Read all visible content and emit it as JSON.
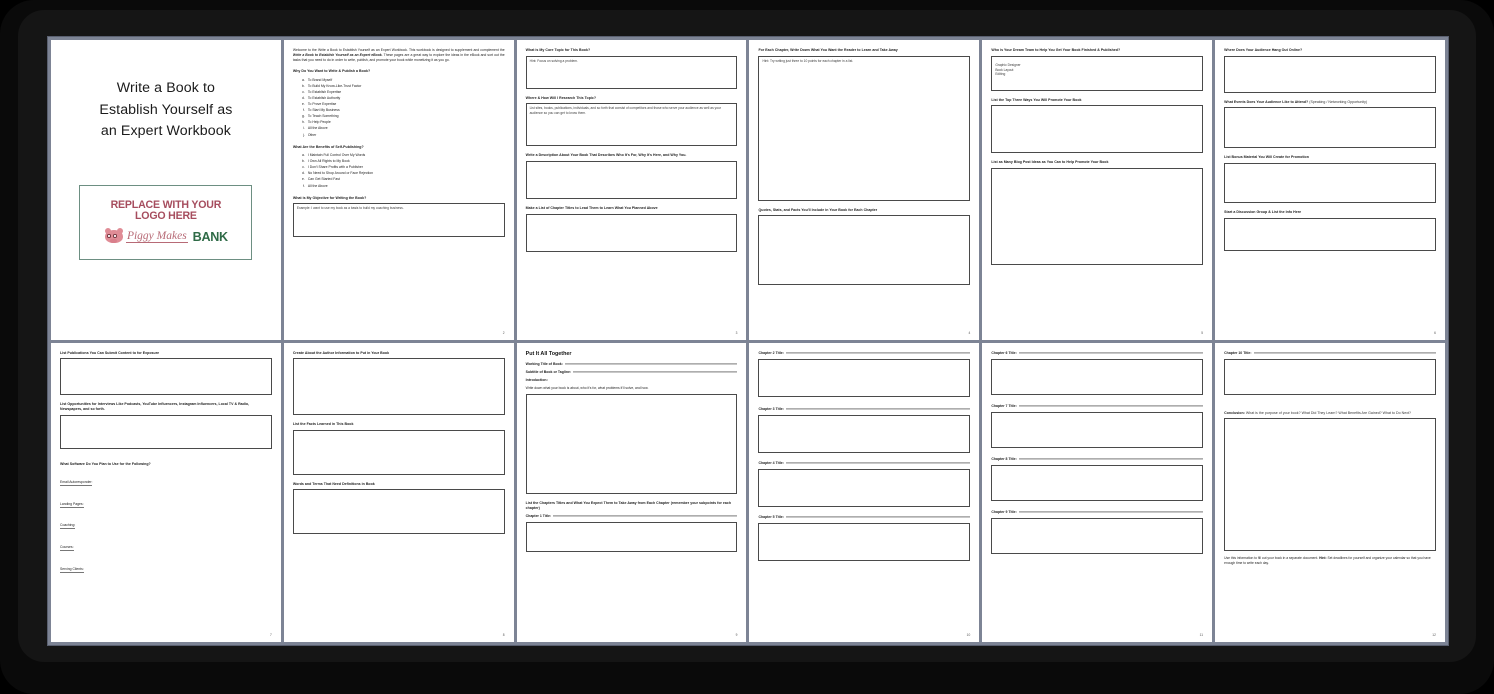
{
  "viewer": {
    "kind": "pdf-thumbnail-grid",
    "columns": 6,
    "rows": 2,
    "total_pages": 12
  },
  "cover": {
    "title": "Write a Book to Establish Yourself as an Expert Workbook",
    "title_lines": [
      "Write a Book to",
      "Establish Yourself as",
      "an Expert Workbook"
    ],
    "logo_placeholder_line1": "REPLACE WITH YOUR",
    "logo_placeholder_line2": "LOGO HERE",
    "brand_piggy": "Piggy Makes",
    "brand_bank": "BANK",
    "colors": {
      "placeholder_text": "#a64d5e",
      "logo_box_border": "#6d8f82",
      "piggy_pink": "#e08c96",
      "bank_green": "#2f6b47"
    }
  },
  "page2": {
    "page_number": "2",
    "intro_a": "Welcome to the Write a Book to Establish Yourself as an Expert Workbook. This workbook is designed to supplement and complement the ",
    "intro_b": "Write a Book to Establish Yourself as an Expert eBook.",
    "intro_c": " These pages are a great way to explore the ideas in the eBook and sort out the tasks that you need to do in order to write, publish, and promote your book while monetizing it as you go.",
    "q1": "Why Do You Want to Write & Publish a Book?",
    "q1_options": [
      "To Brand Myself",
      "To Build My Know-Like-Trust Factor",
      "To Establish Expertise",
      "To Establish Authority",
      "To Prove Expertise",
      "To Start My Business",
      "To Teach Something",
      "To Help People",
      "All the Above",
      "Other"
    ],
    "q2": "What Are the Benefits of Self-Publishing?",
    "q2_options": [
      "I Maintain Full Control Over My Words",
      "I Own All Rights to My Book",
      "I Don't Share Profits with a Publisher",
      "No Need to Shop Around or Face Rejection",
      "Can Get Started Fast",
      "All the Above"
    ],
    "q3": "What is My Objective for Writing the Book?",
    "q3_prefill": "Example: I want to use my book as a basis to build my coaching business."
  },
  "page3": {
    "page_number": "3",
    "q1": "What is My Core Topic for This Book?",
    "q1_prefill": "Hint: Focus on solving a problem.",
    "q2": "Where & How Will I Research This Topic?",
    "q2_prefill": "List sites, books, publications, individuals, and so forth that consist of competitors and those who serve your audience as well as your audience so you can get to know them.",
    "q3": "Write a Description About Your Book That Describes Who It's For, Why It's Here, and Why You.",
    "q4": "Make a List of Chapter Titles to Lead Them to Learn What You Planned Above"
  },
  "page4": {
    "page_number": "4",
    "q1": "For Each Chapter, Write Down What You Want the Reader to Learn and Take Away",
    "q1_prefill": "Hint: Try writing just three to 10 points for each chapter in a list.",
    "q2": "Quotes, Stats, and Facts You'll Include in Your Book for Each Chapter"
  },
  "page5": {
    "page_number": "5",
    "q1": "Who is Your Dream Team to Help You Get Your Book Finished & Published?",
    "q1_prefill": "Graphic Designer\nBook Layout\nEditing",
    "q2": "List the Top Three Ways You Will Promote Your Book",
    "q3": "List as Many Blog Post Ideas as You Can to Help Promote Your Book"
  },
  "page6": {
    "page_number": "6",
    "q1": "Where Does Your Audience Hang Out Online?",
    "q2_bold": "What Events Does Your Audience Like to Attend?",
    "q2_light": " (Speaking / Networking Opportunity)",
    "q3": "List Bonus Material You Will Create for Promotion",
    "q4": "Start a Discussion Group & List the Info Here"
  },
  "page7": {
    "page_number": "7",
    "q1": "List Publications You Can Submit Content to for Exposure",
    "q2": "List Opportunities for Interviews Like Podcasts, YouTube Influencers, Instagram Influencers, Local TV & Radio, Newspapers, and so forth.",
    "q3": "What Software Do You Plan to Use for the Following?",
    "software_items": [
      "Email Autoresponder:",
      "Landing Pages:",
      "Coaching:",
      "Courses:",
      "Serving Clients:"
    ]
  },
  "page8": {
    "page_number": "8",
    "q1": "Create About the Author Information to Put in Your Book",
    "q2": "List the Facts Learned in This Book",
    "q3": "Words and Terms That Need Definitions in Book"
  },
  "page9": {
    "page_number": "9",
    "title": "Put It All Together",
    "field1": "Working Title of Book:",
    "field2": "Subtitle of Book or Tagline:",
    "field3": "Introduction:",
    "note": "Write down what your book is about, who it's for, what problems it'll solve, and how.",
    "q_chapters": "List the Chapters Titles and What You Expect Them to Take Away from Each Chapter (remember your subpoints for each chapter)",
    "chapter1": "Chapter 1 Title:"
  },
  "page10": {
    "page_number": "10",
    "chapters": [
      "Chapter 2 Title:",
      "Chapter 3 Title:",
      "Chapter 4 Title:",
      "Chapter 5 Title:"
    ]
  },
  "page11": {
    "page_number": "11",
    "chapters": [
      "Chapter 6 Title:",
      "Chapter 7 Title:",
      "Chapter 8 Title:",
      "Chapter 9 Title:"
    ]
  },
  "page12": {
    "page_number": "12",
    "chapter10": "Chapter 10 Title:",
    "conclusion_bold": "Conclusion:",
    "conclusion_light": " What is the purpose of your book? What Did They Learn? What Benefits Are Gained? What to Do Next?",
    "footer_a": "Use this information to fill out your book in a separate document. ",
    "footer_bold": "Hint:",
    "footer_b": " Set deadlines for yourself and organize your calendar so that you have enough time to write each day."
  }
}
